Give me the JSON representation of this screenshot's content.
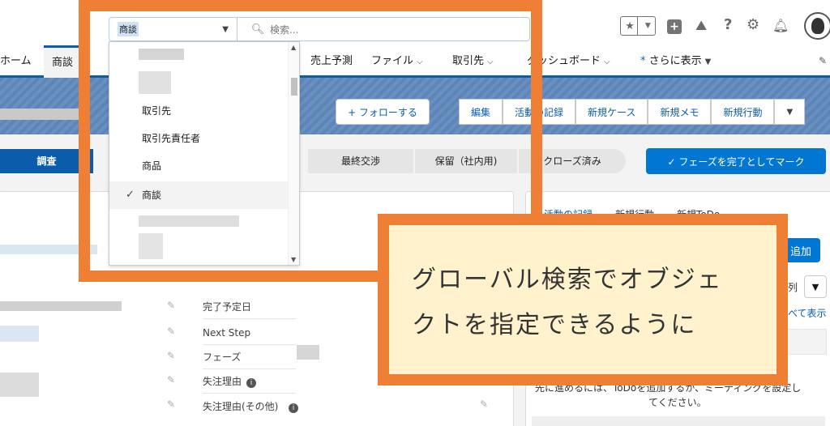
{
  "header": {
    "search_scope": "商談",
    "search_placeholder": "検索..."
  },
  "nav": {
    "home": "ホーム",
    "opportunity": "商談",
    "forecast": "売上予測",
    "files": "ファイル",
    "accounts": "取引先",
    "dashboards": "ダッシュボード",
    "more": "さらに表示",
    "more_star": "*"
  },
  "actions": {
    "follow": "+ フォローする",
    "edit": "編集",
    "activity_log": "活動の記録",
    "new_case": "新規ケース",
    "new_note": "新規メモ",
    "new_action": "新規行動"
  },
  "path": {
    "stages": [
      "調査",
      "最終交渉",
      "保留（社内用)",
      "クローズ済み"
    ],
    "complete_button": "✓ フェーズを完了としてマーク"
  },
  "dropdown": {
    "items": [
      "取引先",
      "取引先責任者",
      "商品",
      "商談"
    ],
    "selected": "商談"
  },
  "fields": {
    "close_date": "完了予定日",
    "next_step": "Next Step",
    "phase": "フェーズ",
    "loss_reason": "失注理由",
    "loss_reason_other": "失注理由(その他)"
  },
  "activity": {
    "tabs": [
      "活動の記録",
      "新規行動",
      "新規ToDo"
    ],
    "add": "追加",
    "filter_label": "列",
    "show_all": "べて表示",
    "empty_msg_1": "先に進めるには、ToDoを追加するか、ミーティングを設定し",
    "empty_msg_2": "てください。"
  },
  "callout": {
    "line1": "グローバル検索でオブジェ",
    "line2": "クトを指定できるように"
  },
  "colors": {
    "accent": "#ef7f35",
    "brand": "#0b5cab",
    "callout_bg": "#fff2cc"
  }
}
